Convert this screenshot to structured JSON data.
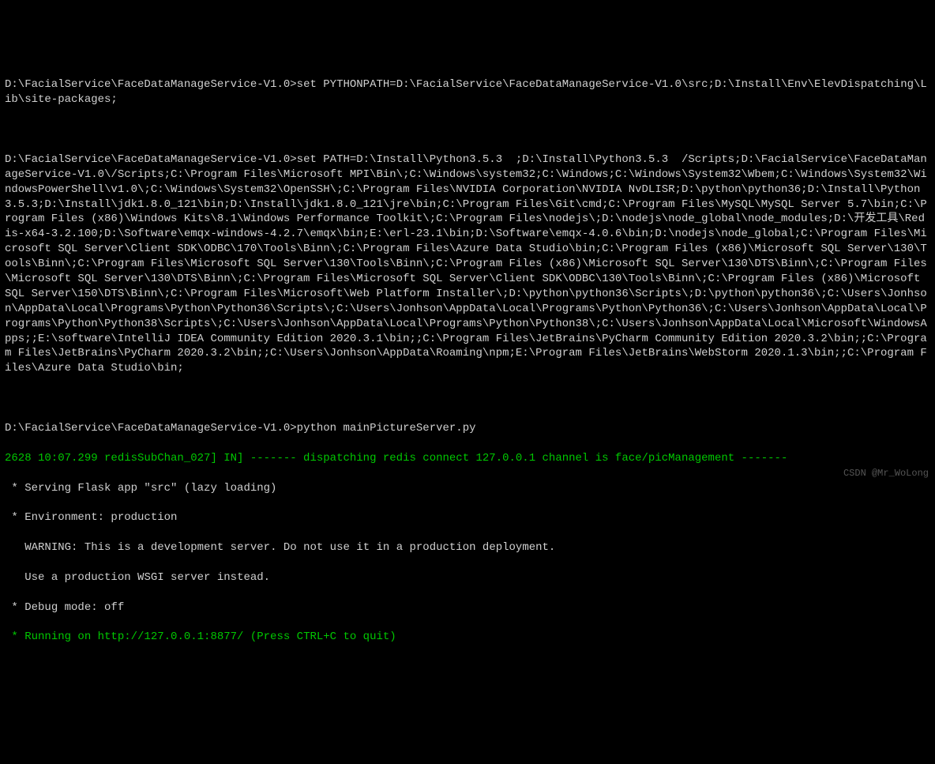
{
  "terminal": {
    "line1_prompt": "D:\\FacialService\\FaceDataManageService-V1.0>",
    "line1_cmd": "set PYTHONPATH=D:\\FacialService\\FaceDataManageService-V1.0\\src;D:\\Install\\Env\\ElevDispatching\\Lib\\site-packages;",
    "line2_prompt": "D:\\FacialService\\FaceDataManageService-V1.0>",
    "line2_cmd": "set PATH=D:\\Install\\Python3.5.3  ;D:\\Install\\Python3.5.3  /Scripts;D:\\FacialService\\FaceDataManageService-V1.0\\/Scripts;C:\\Program Files\\Microsoft MPI\\Bin\\;C:\\Windows\\system32;C:\\Windows;C:\\Windows\\System32\\Wbem;C:\\Windows\\System32\\WindowsPowerShell\\v1.0\\;C:\\Windows\\System32\\OpenSSH\\;C:\\Program Files\\NVIDIA Corporation\\NVIDIA NvDLISR;D:\\python\\python36;D:\\Install\\Python3.5.3;D:\\Install\\jdk1.8.0_121\\bin;D:\\Install\\jdk1.8.0_121\\jre\\bin;C:\\Program Files\\Git\\cmd;C:\\Program Files\\MySQL\\MySQL Server 5.7\\bin;C:\\Program Files (x86)\\Windows Kits\\8.1\\Windows Performance Toolkit\\;C:\\Program Files\\nodejs\\;D:\\nodejs\\node_global\\node_modules;D:\\开发工具\\Redis-x64-3.2.100;D:\\Software\\emqx-windows-4.2.7\\emqx\\bin;E:\\erl-23.1\\bin;D:\\Software\\emqx-4.0.6\\bin;D:\\nodejs\\node_global;C:\\Program Files\\Microsoft SQL Server\\Client SDK\\ODBC\\170\\Tools\\Binn\\;C:\\Program Files\\Azure Data Studio\\bin;C:\\Program Files (x86)\\Microsoft SQL Server\\130\\Tools\\Binn\\;C:\\Program Files\\Microsoft SQL Server\\130\\Tools\\Binn\\;C:\\Program Files (x86)\\Microsoft SQL Server\\130\\DTS\\Binn\\;C:\\Program Files\\Microsoft SQL Server\\130\\DTS\\Binn\\;C:\\Program Files\\Microsoft SQL Server\\Client SDK\\ODBC\\130\\Tools\\Binn\\;C:\\Program Files (x86)\\Microsoft SQL Server\\150\\DTS\\Binn\\;C:\\Program Files\\Microsoft\\Web Platform Installer\\;D:\\python\\python36\\Scripts\\;D:\\python\\python36\\;C:\\Users\\Jonhson\\AppData\\Local\\Programs\\Python\\Python36\\Scripts\\;C:\\Users\\Jonhson\\AppData\\Local\\Programs\\Python\\Python36\\;C:\\Users\\Jonhson\\AppData\\Local\\Programs\\Python\\Python38\\Scripts\\;C:\\Users\\Jonhson\\AppData\\Local\\Programs\\Python\\Python38\\;C:\\Users\\Jonhson\\AppData\\Local\\Microsoft\\WindowsApps;;E:\\software\\IntelliJ IDEA Community Edition 2020.3.1\\bin;;C:\\Program Files\\JetBrains\\PyCharm Community Edition 2020.3.2\\bin;;C:\\Program Files\\JetBrains\\PyCharm 2020.3.2\\bin;;C:\\Users\\Jonhson\\AppData\\Roaming\\npm;E:\\Program Files\\JetBrains\\WebStorm 2020.1.3\\bin;;C:\\Program Files\\Azure Data Studio\\bin;",
    "line3_prompt": "D:\\FacialService\\FaceDataManageService-V1.0>",
    "line3_cmd": "python mainPictureServer.py",
    "log_line": "2628 10:07.299 redisSubChan_027] IN] ------- dispatching redis connect 127.0.0.1 channel is face/picManagement -------",
    "flask1": " * Serving Flask app \"src\" (lazy loading)",
    "flask2": " * Environment: production",
    "flask3": "   WARNING: This is a development server. Do not use it in a production deployment.",
    "flask4": "   Use a production WSGI server instead.",
    "flask5": " * Debug mode: off",
    "flask6": " * Running on http://127.0.0.1:8877/ (Press CTRL+C to quit)"
  },
  "watermark": "CSDN @Mr_WoLong"
}
